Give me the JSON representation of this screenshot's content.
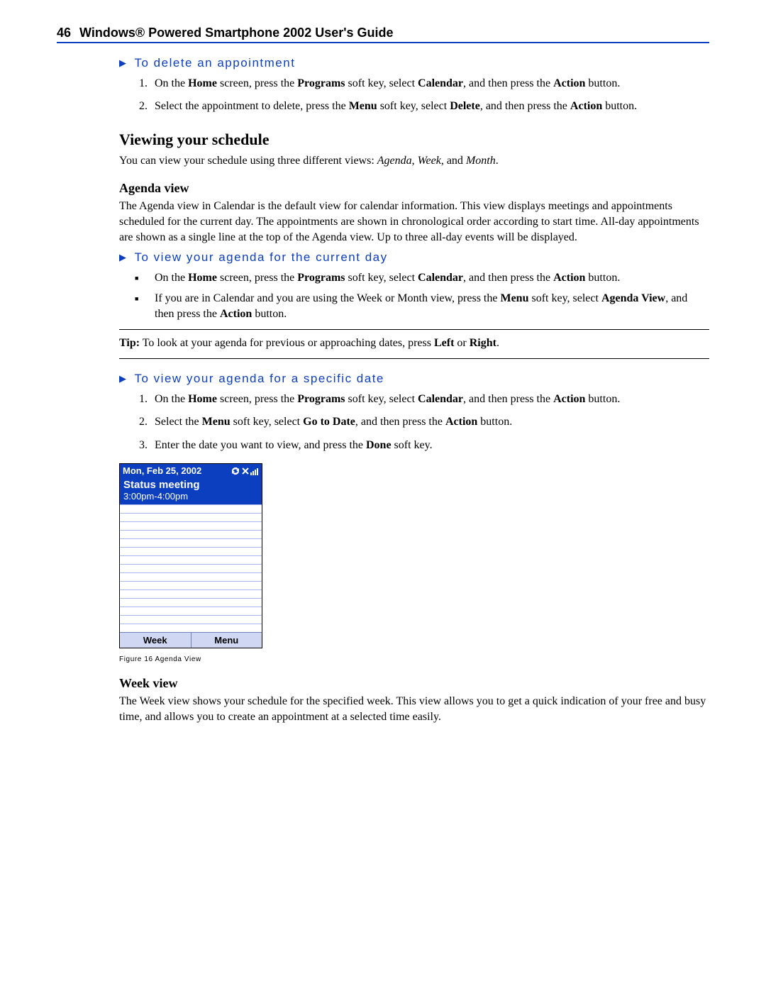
{
  "header": {
    "page_number": "46",
    "title": "Windows® Powered Smartphone 2002 User's Guide"
  },
  "sections": {
    "delete_task": {
      "heading": "To delete an appointment",
      "step1_pre": "On the ",
      "step1_b1": "Home",
      "step1_mid1": " screen, press the ",
      "step1_b2": "Programs",
      "step1_mid2": " soft key, select ",
      "step1_b3": "Calendar",
      "step1_mid3": ", and then press the ",
      "step1_b4": "Action",
      "step1_post": " button.",
      "step2_pre": "Select the appointment to delete, press the ",
      "step2_b1": "Menu",
      "step2_mid1": " soft key, select ",
      "step2_b2": "Delete",
      "step2_mid2": ", and then press the ",
      "step2_b3": "Action",
      "step2_post": " button."
    },
    "viewing": {
      "heading": "Viewing your schedule",
      "intro_pre": "You can view your schedule using three different views: ",
      "intro_i1": "Agenda",
      "intro_sep1": ", ",
      "intro_i2": "Week",
      "intro_sep2": ", and ",
      "intro_i3": "Month",
      "intro_post": "."
    },
    "agenda_view": {
      "heading": "Agenda view",
      "para": "The Agenda view in Calendar is the default view for calendar information. This view displays meetings and appointments scheduled for the current day. The appointments are shown in chronological order according to start time. All-day appointments are shown as a single line at the top of the Agenda view. Up to three all-day events will be displayed."
    },
    "current_day": {
      "heading": "To view your agenda for the current day",
      "b1_pre": "On the ",
      "b1_b1": "Home",
      "b1_mid1": " screen, press the ",
      "b1_b2": "Programs",
      "b1_mid2": " soft key, select ",
      "b1_b3": "Calendar",
      "b1_mid3": ", and then press the ",
      "b1_b4": "Action",
      "b1_post": " button.",
      "b2_pre": "If you are in Calendar and you are using the Week or Month view, press the ",
      "b2_b1": "Menu",
      "b2_mid1": " soft key, select ",
      "b2_b2": "Agenda View",
      "b2_mid2": ", and then press the ",
      "b2_b3": "Action",
      "b2_post": " button."
    },
    "tip": {
      "label": "Tip:",
      "pre": "  To look at your agenda for previous or approaching dates, press ",
      "b1": "Left",
      "mid": " or ",
      "b2": "Right",
      "post": "."
    },
    "specific_date": {
      "heading": "To view your agenda for a specific date",
      "s1_pre": "On the ",
      "s1_b1": "Home",
      "s1_mid1": " screen, press the ",
      "s1_b2": "Programs",
      "s1_mid2": " soft key, select ",
      "s1_b3": "Calendar",
      "s1_mid3": ", and then press the ",
      "s1_b4": "Action",
      "s1_post": " button.",
      "s2_pre": "Select the ",
      "s2_b1": "Menu",
      "s2_mid1": " soft key, select ",
      "s2_b2": "Go to Date",
      "s2_mid2": ", and then press the ",
      "s2_b3": "Action",
      "s2_post": " button.",
      "s3_pre": "Enter the date you want to view, and press the ",
      "s3_b1": "Done",
      "s3_post": " soft key."
    },
    "figure": {
      "date": "Mon, Feb 25, 2002",
      "meeting_title": "Status meeting",
      "meeting_time": "3:00pm-4:00pm",
      "softkey_left": "Week",
      "softkey_right": "Menu",
      "caption": "Figure 16 Agenda View"
    },
    "week_view": {
      "heading": "Week view",
      "para": "The Week view shows your schedule for the specified week. This view allows you to get a quick indication of your free and busy time, and allows you to create an appointment at a selected time easily."
    }
  }
}
